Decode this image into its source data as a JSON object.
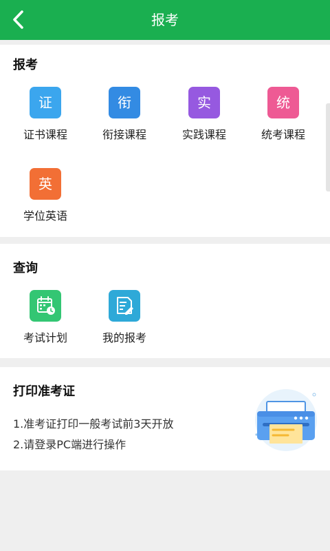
{
  "header": {
    "title": "报考",
    "back_icon": "chevron-left-icon",
    "background_color": "#1aaf50"
  },
  "registration": {
    "title": "报考",
    "items": [
      {
        "label": "证书课程",
        "glyph": "证",
        "color": "#3ba6ee"
      },
      {
        "label": "衔接课程",
        "glyph": "衔",
        "color": "#338be3"
      },
      {
        "label": "实践课程",
        "glyph": "实",
        "color": "#9659e0"
      },
      {
        "label": "统考课程",
        "glyph": "统",
        "color": "#ee5a94"
      },
      {
        "label": "学位英语",
        "glyph": "英",
        "color": "#f26f35"
      }
    ]
  },
  "query": {
    "title": "查询",
    "items": [
      {
        "label": "考试计划",
        "icon": "calendar-clock-icon",
        "color": "#33c673"
      },
      {
        "label": "我的报考",
        "icon": "document-edit-icon",
        "color": "#2ea9d8"
      }
    ]
  },
  "print_ticket": {
    "title": "打印准考证",
    "lines": [
      "1.准考证打印一般考试前3天开放",
      "2.请登录PC端进行操作"
    ],
    "illustration_icon": "printer-icon"
  }
}
